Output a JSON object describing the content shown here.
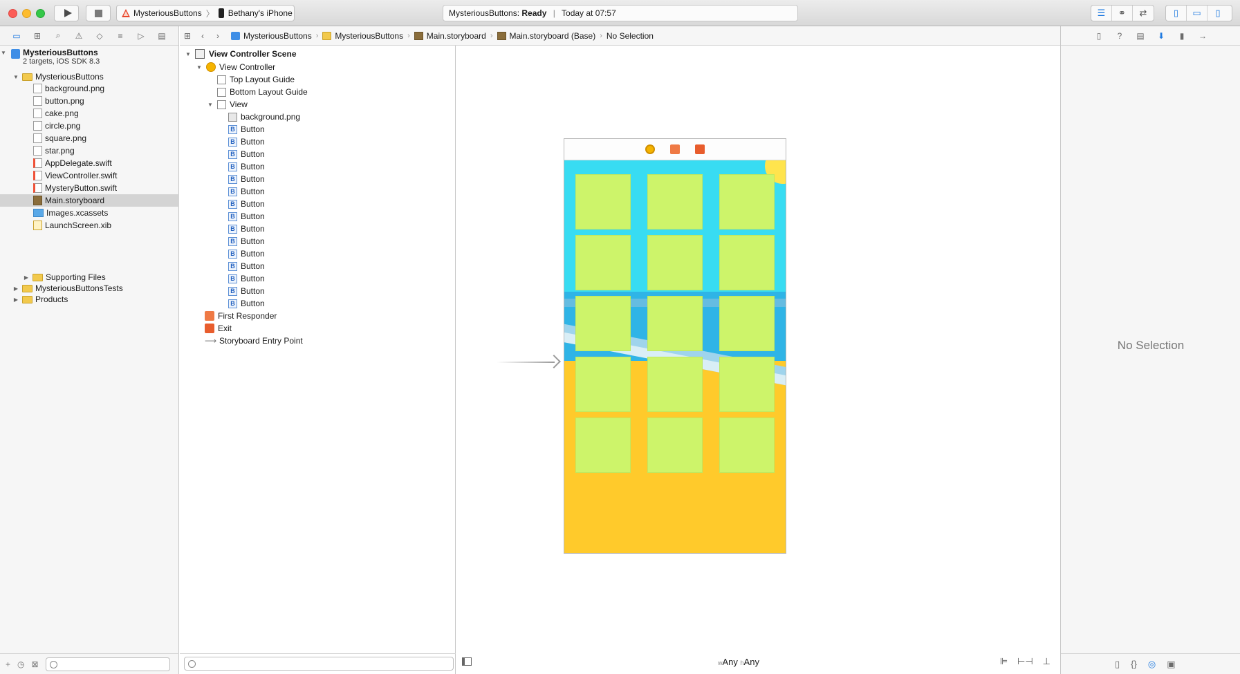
{
  "toolbar": {
    "scheme_name": "MysteriousButtons",
    "device_name": "Bethany's iPhone",
    "status_project": "MysteriousButtons:",
    "status_state": "Ready",
    "status_time": "Today at 07:57",
    "editor_icons": [
      "standard-editor-icon",
      "assistant-editor-icon",
      "version-editor-icon"
    ],
    "view_icons": [
      "navigator-toggle-icon",
      "debug-area-toggle-icon",
      "utilities-toggle-icon"
    ]
  },
  "navigator": {
    "tabs": [
      "project-navigator-icon",
      "symbol-navigator-icon",
      "find-navigator-icon",
      "issue-navigator-icon",
      "test-navigator-icon",
      "debug-navigator-icon",
      "breakpoint-navigator-icon",
      "report-navigator-icon"
    ],
    "project_name": "MysteriousButtons",
    "project_subtitle": "2 targets, iOS SDK 8.3",
    "group_name": "MysteriousButtons",
    "files": [
      {
        "name": "background.png",
        "type": "png"
      },
      {
        "name": "button.png",
        "type": "png"
      },
      {
        "name": "cake.png",
        "type": "png"
      },
      {
        "name": "circle.png",
        "type": "png"
      },
      {
        "name": "square.png",
        "type": "png"
      },
      {
        "name": "star.png",
        "type": "png"
      },
      {
        "name": "AppDelegate.swift",
        "type": "swift"
      },
      {
        "name": "ViewController.swift",
        "type": "swift"
      },
      {
        "name": "MysteryButton.swift",
        "type": "swift"
      },
      {
        "name": "Main.storyboard",
        "type": "storyboard",
        "selected": true
      },
      {
        "name": "Images.xcassets",
        "type": "assets"
      },
      {
        "name": "LaunchScreen.xib",
        "type": "xib"
      }
    ],
    "supporting_files": "Supporting Files",
    "tests_group": "MysteriousButtonsTests",
    "products_group": "Products"
  },
  "jumpbar": {
    "crumbs": [
      "MysteriousButtons",
      "MysteriousButtons",
      "Main.storyboard",
      "Main.storyboard (Base)",
      "No Selection"
    ]
  },
  "outline": {
    "scene_title": "View Controller Scene",
    "view_controller": "View Controller",
    "top_guide": "Top Layout Guide",
    "bottom_guide": "Bottom Layout Guide",
    "view": "View",
    "background": "background.png",
    "button_label": "Button",
    "button_count": 15,
    "first_responder": "First Responder",
    "exit": "Exit",
    "entry_point": "Storyboard Entry Point"
  },
  "canvas": {
    "size_w_prefix": "w",
    "size_w": "Any",
    "size_h_prefix": "h",
    "size_h": "Any",
    "button_grid": {
      "rows": 5,
      "cols": 3
    },
    "colors": {
      "button": "#cdf46a",
      "sky": "#38dcf2",
      "sand": "#ffca2b"
    }
  },
  "inspector": {
    "tabs": [
      "file-inspector-icon",
      "quick-help-icon",
      "identity-inspector-icon",
      "attributes-inspector-icon",
      "size-inspector-icon",
      "connections-inspector-icon"
    ],
    "empty_text": "No Selection",
    "library_tabs": [
      "file-template-icon",
      "code-snippet-icon",
      "object-library-icon",
      "media-library-icon"
    ]
  }
}
